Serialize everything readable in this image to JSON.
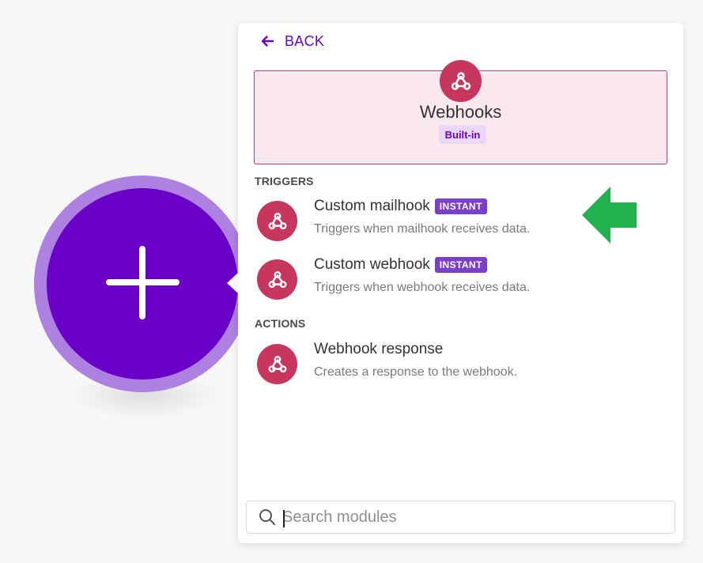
{
  "canvas": {
    "add_module_icon": "plus-icon",
    "bubble_color": "#6a00c8",
    "bubble_ring_color": "#ae80e1"
  },
  "panel": {
    "back_label": "BACK",
    "app": {
      "name": "Webhooks",
      "badge": "Built-in",
      "icon": "webhook-icon",
      "brand_color": "#c7365f"
    },
    "sections": [
      {
        "label": "TRIGGERS",
        "modules": [
          {
            "title": "Custom mailhook",
            "badge": "INSTANT",
            "description": "Triggers when mailhook receives data."
          },
          {
            "title": "Custom webhook",
            "badge": "INSTANT",
            "description": "Triggers when webhook receives data."
          }
        ]
      },
      {
        "label": "ACTIONS",
        "modules": [
          {
            "title": "Webhook response",
            "description": "Creates a response to the webhook."
          }
        ]
      }
    ],
    "search": {
      "placeholder": "Search modules",
      "value": ""
    }
  },
  "annotation": {
    "arrow_color": "#22b14c",
    "arrow_icon": "left-arrow-icon"
  }
}
